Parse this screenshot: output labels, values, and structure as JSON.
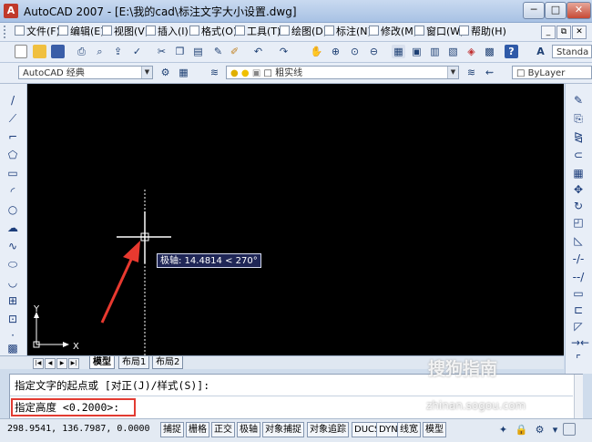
{
  "window": {
    "title": "AutoCAD 2007 - [E:\\我的cad\\标注文字大小设置.dwg]",
    "app_icon": "A",
    "min": "─",
    "max": "□",
    "close": "✕"
  },
  "menu": {
    "items": [
      "文件(F)",
      "编辑(E)",
      "视图(V)",
      "插入(I)",
      "格式(O)",
      "工具(T)",
      "绘图(D)",
      "标注(N)",
      "修改(M)",
      "窗口(W)",
      "帮助(H)"
    ],
    "mdi": [
      "_",
      "⧉",
      "✕"
    ]
  },
  "toolbar": {
    "text_style": "Standa",
    "workspace": "AutoCAD 经典",
    "linetype": "粗实线",
    "linetype_icon": "lightbulb-sun-lock-icons",
    "bylayer": "ByLayer"
  },
  "canvas": {
    "tooltip": "极轴: 14.4814 < 270°",
    "ucs_y": "Y",
    "ucs_x": "X"
  },
  "tabs": [
    "模型",
    "布局1",
    "布局2"
  ],
  "command": {
    "line1": "指定文字的起点或 [对正(J)/样式(S)]:",
    "line2": "指定高度 <0.2000>:"
  },
  "status": {
    "coords": "298.9541, 136.7987, 0.0000",
    "buttons": [
      "捕捉",
      "栅格",
      "正交",
      "极轴",
      "对象捕捉",
      "对象追踪",
      "DUCS",
      "DYN",
      "线宽",
      "模型"
    ]
  },
  "watermark": {
    "text": "搜狗指南",
    "url": "zhinan.sogou.com"
  },
  "colors": {
    "canvas": "#000000",
    "highlight": "#e23b32",
    "tooltip_bg": "#1f2656"
  }
}
